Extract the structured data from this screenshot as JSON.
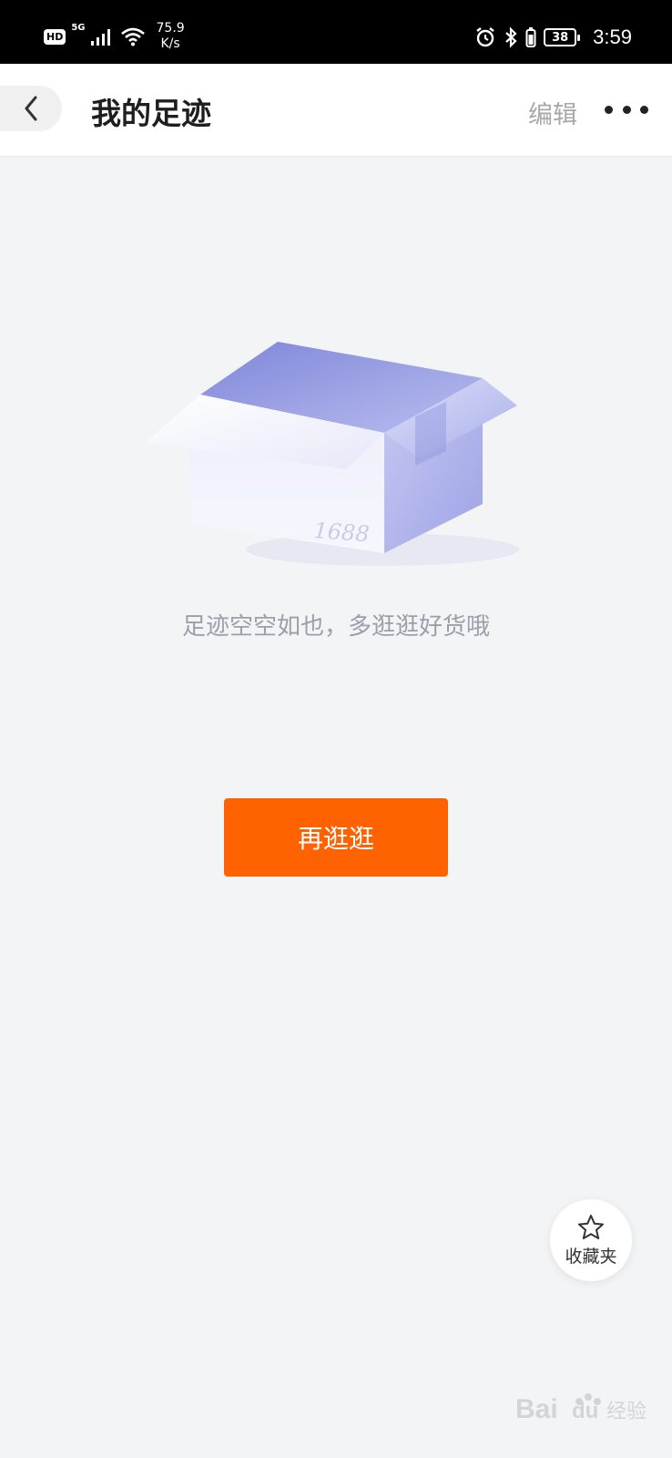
{
  "status_bar": {
    "hd": "HD",
    "network": "5G",
    "speed_value": "75.9",
    "speed_unit": "K/s",
    "battery": "38",
    "time": "3:59",
    "icons": [
      "signal-icon",
      "wifi-icon",
      "alarm-icon",
      "bluetooth-icon",
      "battery-saver-icon"
    ]
  },
  "header": {
    "title": "我的足迹",
    "edit_label": "编辑",
    "back_icon": "chevron-left-icon",
    "more_icon": "more-dots-icon"
  },
  "empty_state": {
    "illustration": "open-box-illustration",
    "box_number": "1688",
    "message": "足迹空空如也，多逛逛好货哦",
    "button_label": "再逛逛"
  },
  "favorites": {
    "label": "收藏夹",
    "icon": "star-icon"
  },
  "colors": {
    "accent": "#ff6200",
    "background": "#f3f4f6"
  }
}
